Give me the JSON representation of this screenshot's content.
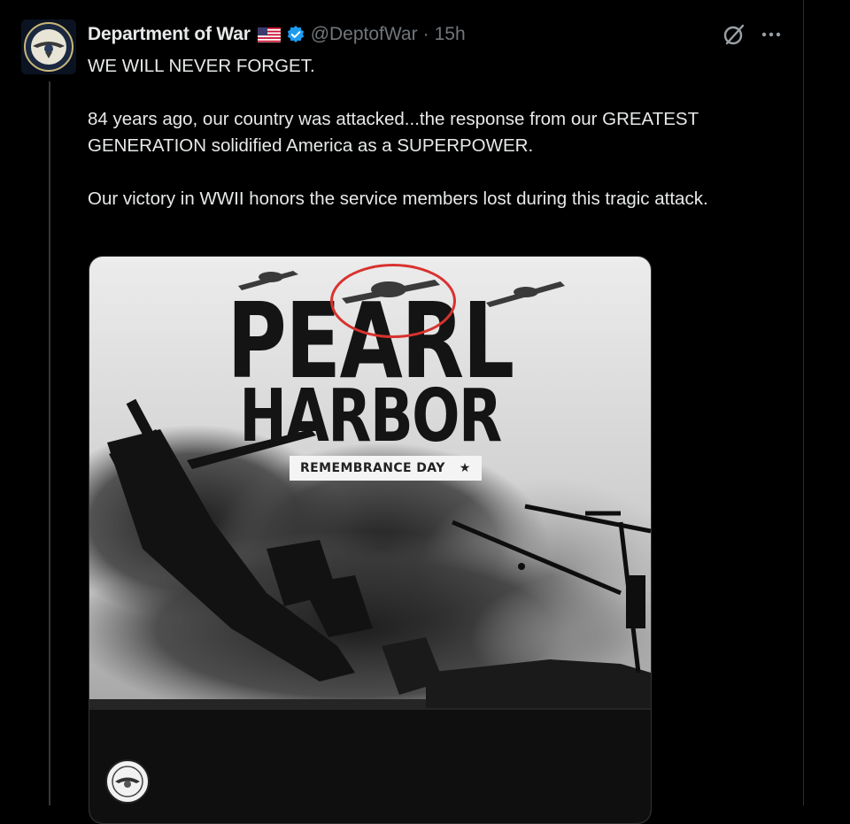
{
  "post": {
    "author": {
      "display_name": "Department of War",
      "handle": "@DeptofWar",
      "separator": "·",
      "time": "15h",
      "badges": [
        "us-flag-icon",
        "verified-badge-icon"
      ]
    },
    "text_paragraphs": [
      "WE WILL NEVER FORGET.",
      "84 years ago, our country was attacked...the response from our GREATEST GENERATION solidified America as a SUPERPOWER.",
      "Our victory in WWII honors the service members lost during this tragic attack."
    ],
    "actions": [
      "grok-icon",
      "more-options-icon"
    ],
    "media": {
      "title_line1": "PEARL",
      "title_line2": "HARBOR",
      "subtitle": "REMEMBRANCE DAY",
      "subtitle_star": "★",
      "annotation": {
        "shape": "ellipse",
        "color": "#d8322f",
        "target": "airplane"
      }
    }
  },
  "colors": {
    "background": "#000000",
    "text": "#e7e9ea",
    "secondary_text": "#71767b",
    "verified": "#1d9bf0",
    "annotation": "#d8322f"
  }
}
